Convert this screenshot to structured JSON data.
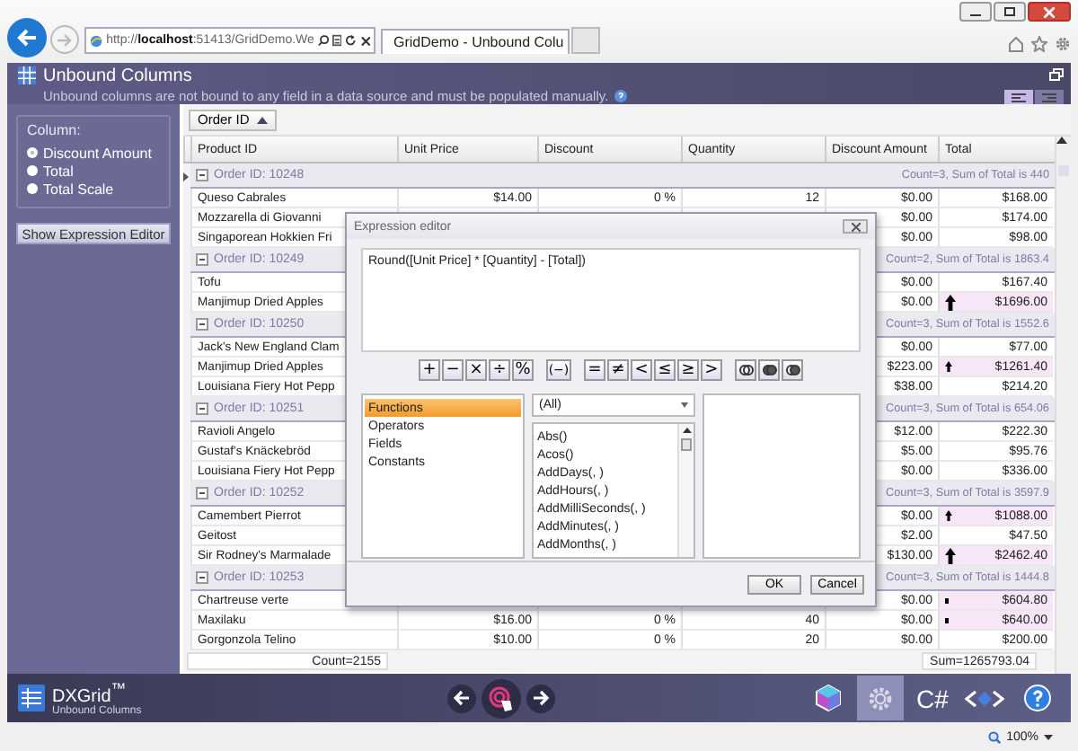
{
  "browser": {
    "address": "http://**localhost**:51413/GridDemo.We",
    "tab": "GridDemo - Unbound Colu"
  },
  "header": {
    "title": "Unbound Columns",
    "description": "Unbound columns are not bound to any field in a data source and must be populated manually.",
    "view_modes": [
      {
        "selected": true
      },
      {
        "selected": false
      }
    ]
  },
  "options": {
    "group_title": "Column:",
    "radios": [
      {
        "label": "Discount Amount",
        "selected": true
      },
      {
        "label": "Total",
        "selected": false
      },
      {
        "label": "Total Scale",
        "selected": false
      }
    ],
    "button": "Show Expression Editor"
  },
  "grid": {
    "group_panel": "Order ID",
    "columns": [
      "Product ID",
      "Unit Price",
      "Discount",
      "Quantity",
      "Discount Amount",
      "Total"
    ],
    "rows": [
      {
        "kind": "group",
        "label": "Order ID: 10248",
        "summary": "Count=3, Sum of Total is 440",
        "expanded": true,
        "focused": true
      },
      {
        "kind": "data",
        "product": "Queso Cabrales",
        "unit_price": "$14.00",
        "discount": "0 %",
        "quantity": "12",
        "discount_amount": "$0.00",
        "total": "$168.00",
        "highlighted": false,
        "focused": false
      },
      {
        "kind": "data",
        "product": "Mozzarella di Giovanni",
        "discount_amount": "$0.00",
        "total": "$174.00",
        "highlighted": false,
        "focused": false
      },
      {
        "kind": "data",
        "product": "Singaporean Hokkien Fri",
        "discount_amount": "$0.00",
        "total": "$98.00",
        "highlighted": false,
        "focused": false
      },
      {
        "kind": "group",
        "label": "Order ID: 10249",
        "summary": "Count=2, Sum of Total is 1863.4",
        "expanded": true,
        "focused": false
      },
      {
        "kind": "data",
        "product": "Tofu",
        "discount_amount": "$0.00",
        "total": "$167.40",
        "highlighted": false,
        "focused": false
      },
      {
        "kind": "data",
        "product": "Manjimup Dried Apples",
        "discount_amount": "$0.00",
        "total": "$1696.00",
        "highlighted": true,
        "indicator": {
          "kind": "large"
        },
        "focused": false
      },
      {
        "kind": "group",
        "label": "Order ID: 10250",
        "summary": "Count=3, Sum of Total is 1552.6",
        "expanded": true,
        "focused": false
      },
      {
        "kind": "data",
        "product": "Jack's New England Clam",
        "discount_amount": "$0.00",
        "total": "$77.00",
        "highlighted": false,
        "focused": false
      },
      {
        "kind": "data",
        "product": "Manjimup Dried Apples",
        "discount_amount": "$223.00",
        "total": "$1261.40",
        "highlighted": true,
        "indicator": {
          "kind": "small"
        },
        "focused": false
      },
      {
        "kind": "data",
        "product": "Louisiana Fiery Hot Pepp",
        "discount_amount": "$38.00",
        "total": "$214.20",
        "highlighted": false,
        "focused": false
      },
      {
        "kind": "group",
        "label": "Order ID: 10251",
        "summary": "Count=3, Sum of Total is 654.06",
        "expanded": true,
        "focused": false
      },
      {
        "kind": "data",
        "product": "Ravioli Angelo",
        "discount_amount": "$12.00",
        "total": "$222.30",
        "highlighted": false,
        "focused": false
      },
      {
        "kind": "data",
        "product": "Gustaf's Knäckebröd",
        "discount_amount": "$5.00",
        "total": "$95.76",
        "highlighted": false,
        "focused": false
      },
      {
        "kind": "data",
        "product": "Louisiana Fiery Hot Pepp",
        "discount_amount": "$0.00",
        "total": "$336.00",
        "highlighted": false,
        "focused": false
      },
      {
        "kind": "group",
        "label": "Order ID: 10252",
        "summary": "Count=3, Sum of Total is 3597.9",
        "expanded": true,
        "focused": false
      },
      {
        "kind": "data",
        "product": "Camembert Pierrot",
        "discount_amount": "$0.00",
        "total": "$1088.00",
        "highlighted": true,
        "indicator": {
          "kind": "small"
        },
        "focused": false
      },
      {
        "kind": "data",
        "product": "Geitost",
        "discount_amount": "$2.00",
        "total": "$47.50",
        "highlighted": false,
        "focused": false
      },
      {
        "kind": "data",
        "product": "Sir Rodney's Marmalade",
        "discount_amount": "$130.00",
        "total": "$2462.40",
        "highlighted": true,
        "indicator": {
          "kind": "large"
        },
        "focused": false
      },
      {
        "kind": "group",
        "label": "Order ID: 10253",
        "summary": "Count=3, Sum of Total is 1444.8",
        "expanded": true,
        "focused": false
      },
      {
        "kind": "data",
        "product": "Chartreuse verte",
        "discount_amount": "$0.00",
        "total": "$604.80",
        "highlighted": true,
        "indicator": {
          "kind": "dot"
        },
        "focused": false
      },
      {
        "kind": "data",
        "product": "Maxilaku",
        "unit_price": "$16.00",
        "discount": "0 %",
        "quantity": "40",
        "discount_amount": "$0.00",
        "total": "$640.00",
        "highlighted": true,
        "indicator": {
          "kind": "dot"
        },
        "focused": false
      },
      {
        "kind": "data",
        "product": "Gorgonzola Telino",
        "unit_price": "$10.00",
        "discount": "0 %",
        "quantity": "20",
        "discount_amount": "$0.00",
        "total": "$200.00",
        "highlighted": false,
        "focused": false
      }
    ],
    "footer": {
      "count": "Count=2155",
      "sum": "Sum=1265793.04"
    }
  },
  "dialog": {
    "title": "Expression editor",
    "expression": "Round([Unit Price] * [Quantity] - [Total])",
    "operator_groups": [
      [
        "+",
        "−",
        "×",
        "÷",
        "%"
      ],
      [
        "(−)"
      ],
      [
        "=",
        "≠",
        "<",
        "≤",
        "≥",
        ">"
      ]
    ],
    "categories": [
      {
        "label": "Functions",
        "selected": true
      },
      {
        "label": "Operators",
        "selected": false
      },
      {
        "label": "Fields",
        "selected": false
      },
      {
        "label": "Constants",
        "selected": false
      }
    ],
    "filter": "(All)",
    "functions": [
      "Abs()",
      "Acos()",
      "AddDays(, )",
      "AddHours(, )",
      "AddMilliSeconds(, )",
      "AddMinutes(, )",
      "AddMonths(, )"
    ],
    "buttons": [
      "OK",
      "Cancel"
    ]
  },
  "bottom_bar": {
    "logo_title": "DXGrid$^{™}$",
    "logo_subtitle": "Unbound Columns",
    "tools": [
      {
        "kind": "cube",
        "selected": false
      },
      {
        "kind": "gear",
        "selected": true
      },
      {
        "kind": "text",
        "label": "C#",
        "selected": false
      },
      {
        "kind": "markup",
        "selected": false
      },
      {
        "kind": "help",
        "selected": false
      }
    ]
  },
  "status_bar": {
    "zoom": "100%"
  }
}
